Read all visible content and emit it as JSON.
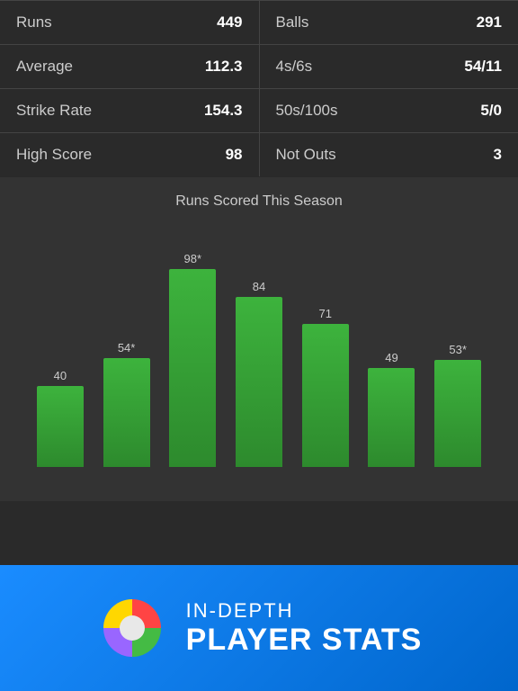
{
  "stats": {
    "left": [
      {
        "label": "Runs",
        "value": "449"
      },
      {
        "label": "Average",
        "value": "112.3"
      },
      {
        "label": "Strike Rate",
        "value": "154.3"
      },
      {
        "label": "High Score",
        "value": "98"
      }
    ],
    "right": [
      {
        "label": "Balls",
        "value": "291"
      },
      {
        "label": "4s/6s",
        "value": "54/11"
      },
      {
        "label": "50s/100s",
        "value": "5/0"
      },
      {
        "label": "Not Outs",
        "value": "3"
      }
    ]
  },
  "chart": {
    "title": "Runs Scored This Season",
    "bars": [
      {
        "label": "40",
        "value": 40
      },
      {
        "label": "54*",
        "value": 54
      },
      {
        "label": "98*",
        "value": 98
      },
      {
        "label": "84",
        "value": 84
      },
      {
        "label": "71",
        "value": 71
      },
      {
        "label": "49",
        "value": 49
      },
      {
        "label": "53*",
        "value": 53
      }
    ],
    "max_value": 98
  },
  "banner": {
    "line1": "IN-DEPTH",
    "line2": "PLAYER STATS"
  }
}
